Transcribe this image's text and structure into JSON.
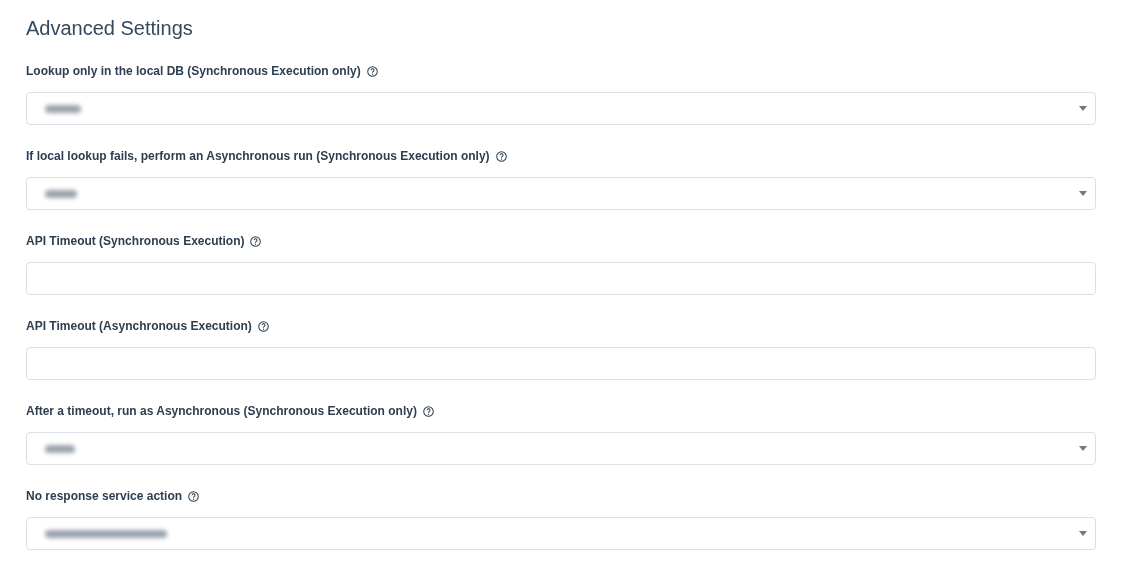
{
  "title": "Advanced Settings",
  "fields": [
    {
      "label": "Lookup only in the local DB (Synchronous Execution only)",
      "kind": "select"
    },
    {
      "label": "If local lookup fails, perform an Asynchronous run (Synchronous Execution only)",
      "kind": "select"
    },
    {
      "label": "API Timeout (Synchronous Execution)",
      "kind": "text"
    },
    {
      "label": "API Timeout (Asynchronous Execution)",
      "kind": "text"
    },
    {
      "label": "After a timeout, run as Asynchronous (Synchronous Execution only)",
      "kind": "select"
    },
    {
      "label": "No response service action",
      "kind": "select"
    }
  ]
}
